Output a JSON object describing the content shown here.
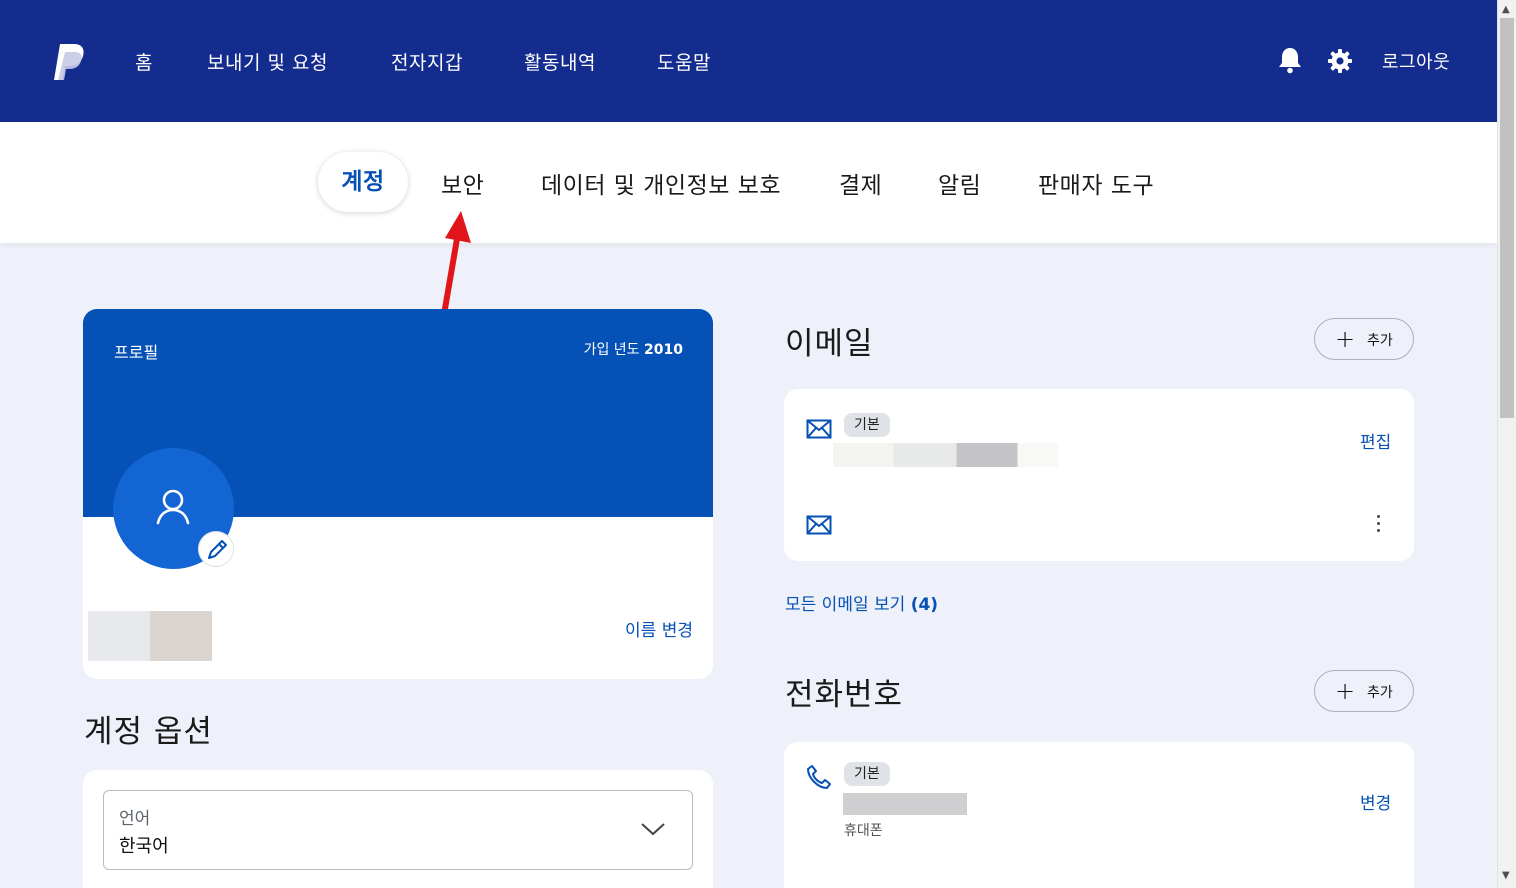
{
  "topnav": {
    "logo_icon": "paypal-logo",
    "items": [
      "홈",
      "보내기 및 요청",
      "전자지갑",
      "활동내역",
      "도움말"
    ],
    "bell_icon": "bell-icon",
    "gear_icon": "gear-icon",
    "logout_label": "로그아웃",
    "background": "#142c8e"
  },
  "subnav": {
    "tabs": [
      "계정",
      "보안",
      "데이터 및 개인정보 보호",
      "결제",
      "알림",
      "판매자 도구"
    ],
    "active_tab": "계정"
  },
  "profile": {
    "label": "프로필",
    "member_since_label": "가입 년도",
    "member_since_year": "2010",
    "change_name_label": "이름 변경",
    "banner_color": "#0551b5"
  },
  "account_options": {
    "title": "계정 옵션",
    "language_label": "언어",
    "language_value": "한국어"
  },
  "email": {
    "title": "이메일",
    "add_label": "추가",
    "primary_badge": "기본",
    "edit_label": "편집",
    "view_all_label": "모든 이메일 보기",
    "view_all_count": "(4)"
  },
  "phone": {
    "title": "전화번호",
    "add_label": "추가",
    "primary_badge": "기본",
    "change_label": "변경",
    "phone_type": "휴대폰"
  },
  "colors": {
    "accent": "#0551b5",
    "page_bg": "#eef1f9",
    "annotation_arrow": "#e0161b"
  }
}
